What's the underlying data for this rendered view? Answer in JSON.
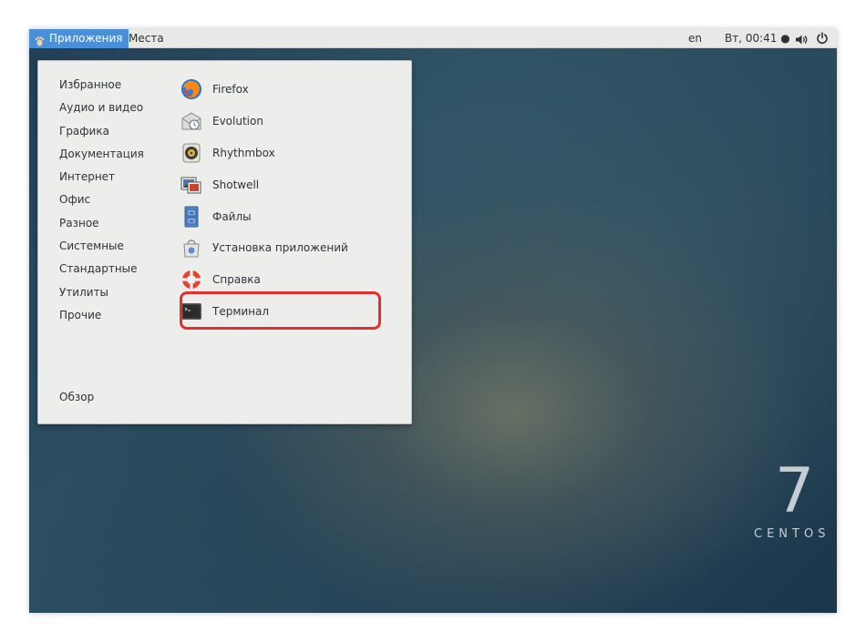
{
  "topbar": {
    "applications_label": "Приложения",
    "places_label": "Места",
    "language": "en",
    "clock": "Вт, 00:41 ●"
  },
  "menu": {
    "categories": [
      {
        "label": "Избранное"
      },
      {
        "label": "Аудио и видео"
      },
      {
        "label": "Графика"
      },
      {
        "label": "Документация"
      },
      {
        "label": "Интернет"
      },
      {
        "label": "Офис"
      },
      {
        "label": "Разное"
      },
      {
        "label": "Системные"
      },
      {
        "label": "Стандартные"
      },
      {
        "label": "Утилиты"
      },
      {
        "label": "Прочие"
      }
    ],
    "overview_label": "Обзор",
    "apps": [
      {
        "label": "Firefox",
        "icon": "firefox-icon"
      },
      {
        "label": "Evolution",
        "icon": "evolution-icon"
      },
      {
        "label": "Rhythmbox",
        "icon": "rhythmbox-icon"
      },
      {
        "label": "Shotwell",
        "icon": "shotwell-icon"
      },
      {
        "label": "Файлы",
        "icon": "files-icon"
      },
      {
        "label": "Установка приложений",
        "icon": "software-icon"
      },
      {
        "label": "Справка",
        "icon": "help-icon"
      },
      {
        "label": "Терминал",
        "icon": "terminal-icon"
      }
    ],
    "highlight_color": "#e0302f"
  },
  "desktop": {
    "version": "7",
    "brand": "CENTOS"
  }
}
